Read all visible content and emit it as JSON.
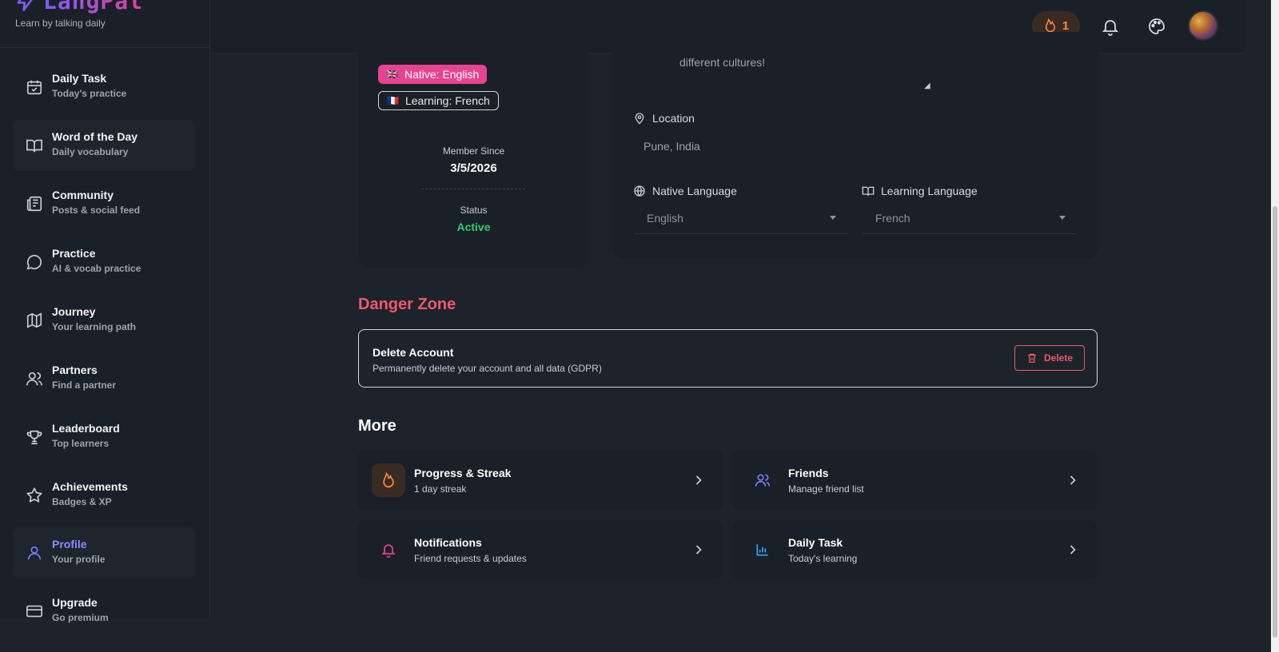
{
  "brand": {
    "name": "LangPal",
    "tagline": "Learn by talking daily"
  },
  "sidebar": {
    "items": [
      {
        "title": "Daily Task",
        "sub": "Today's practice",
        "icon": "calendar-check-icon"
      },
      {
        "title": "Word of the Day",
        "sub": "Daily vocabulary",
        "icon": "book-open-icon"
      },
      {
        "title": "Community",
        "sub": "Posts & social feed",
        "icon": "newspaper-icon"
      },
      {
        "title": "Practice",
        "sub": "AI & vocab practice",
        "icon": "chat-bubble-icon"
      },
      {
        "title": "Journey",
        "sub": "Your learning path",
        "icon": "map-icon"
      },
      {
        "title": "Partners",
        "sub": "Find a partner",
        "icon": "users-icon"
      },
      {
        "title": "Leaderboard",
        "sub": "Top learners",
        "icon": "trophy-icon"
      },
      {
        "title": "Achievements",
        "sub": "Badges & XP",
        "icon": "star-icon"
      },
      {
        "title": "Profile",
        "sub": "Your profile",
        "icon": "user-icon"
      },
      {
        "title": "Upgrade",
        "sub": "Go premium",
        "icon": "credit-card-icon"
      }
    ],
    "active_index": 8
  },
  "topbar": {
    "streak_count": "1"
  },
  "profile_card": {
    "native_tag": "Native: English",
    "native_flag": "🇬🇧",
    "learning_tag": "Learning: French",
    "learning_flag": "🇫🇷",
    "member_since_label": "Member Since",
    "member_since_value": "3/5/2026",
    "status_label": "Status",
    "status_value": "Active"
  },
  "profile_form": {
    "bio_tail": "different cultures!",
    "location_label": "Location",
    "location_value": "Pune, India",
    "native_language_label": "Native Language",
    "native_language_value": "English",
    "learning_language_label": "Learning Language",
    "learning_language_value": "French"
  },
  "danger": {
    "title": "Danger Zone",
    "item_title": "Delete Account",
    "item_sub": "Permanently delete your account and all data (GDPR)",
    "button_label": "Delete"
  },
  "more": {
    "title": "More",
    "cards": [
      {
        "title": "Progress & Streak",
        "sub": "1 day streak",
        "icon": "flame-icon",
        "color": "#ff8a3d"
      },
      {
        "title": "Friends",
        "sub": "Manage friend list",
        "icon": "users-icon",
        "color": "#7c7cff"
      },
      {
        "title": "Notifications",
        "sub": "Friend requests & updates",
        "icon": "bell-icon",
        "color": "#e84393"
      },
      {
        "title": "Daily Task",
        "sub": "Today's learning",
        "icon": "bar-chart-icon",
        "color": "#2ea8ff"
      }
    ]
  },
  "colors": {
    "accent": "#7c7cff",
    "danger": "#f0576b",
    "success": "#2ecc71",
    "pink": "#e84393",
    "bg": "#1d232a",
    "panel": "#1a2027"
  }
}
